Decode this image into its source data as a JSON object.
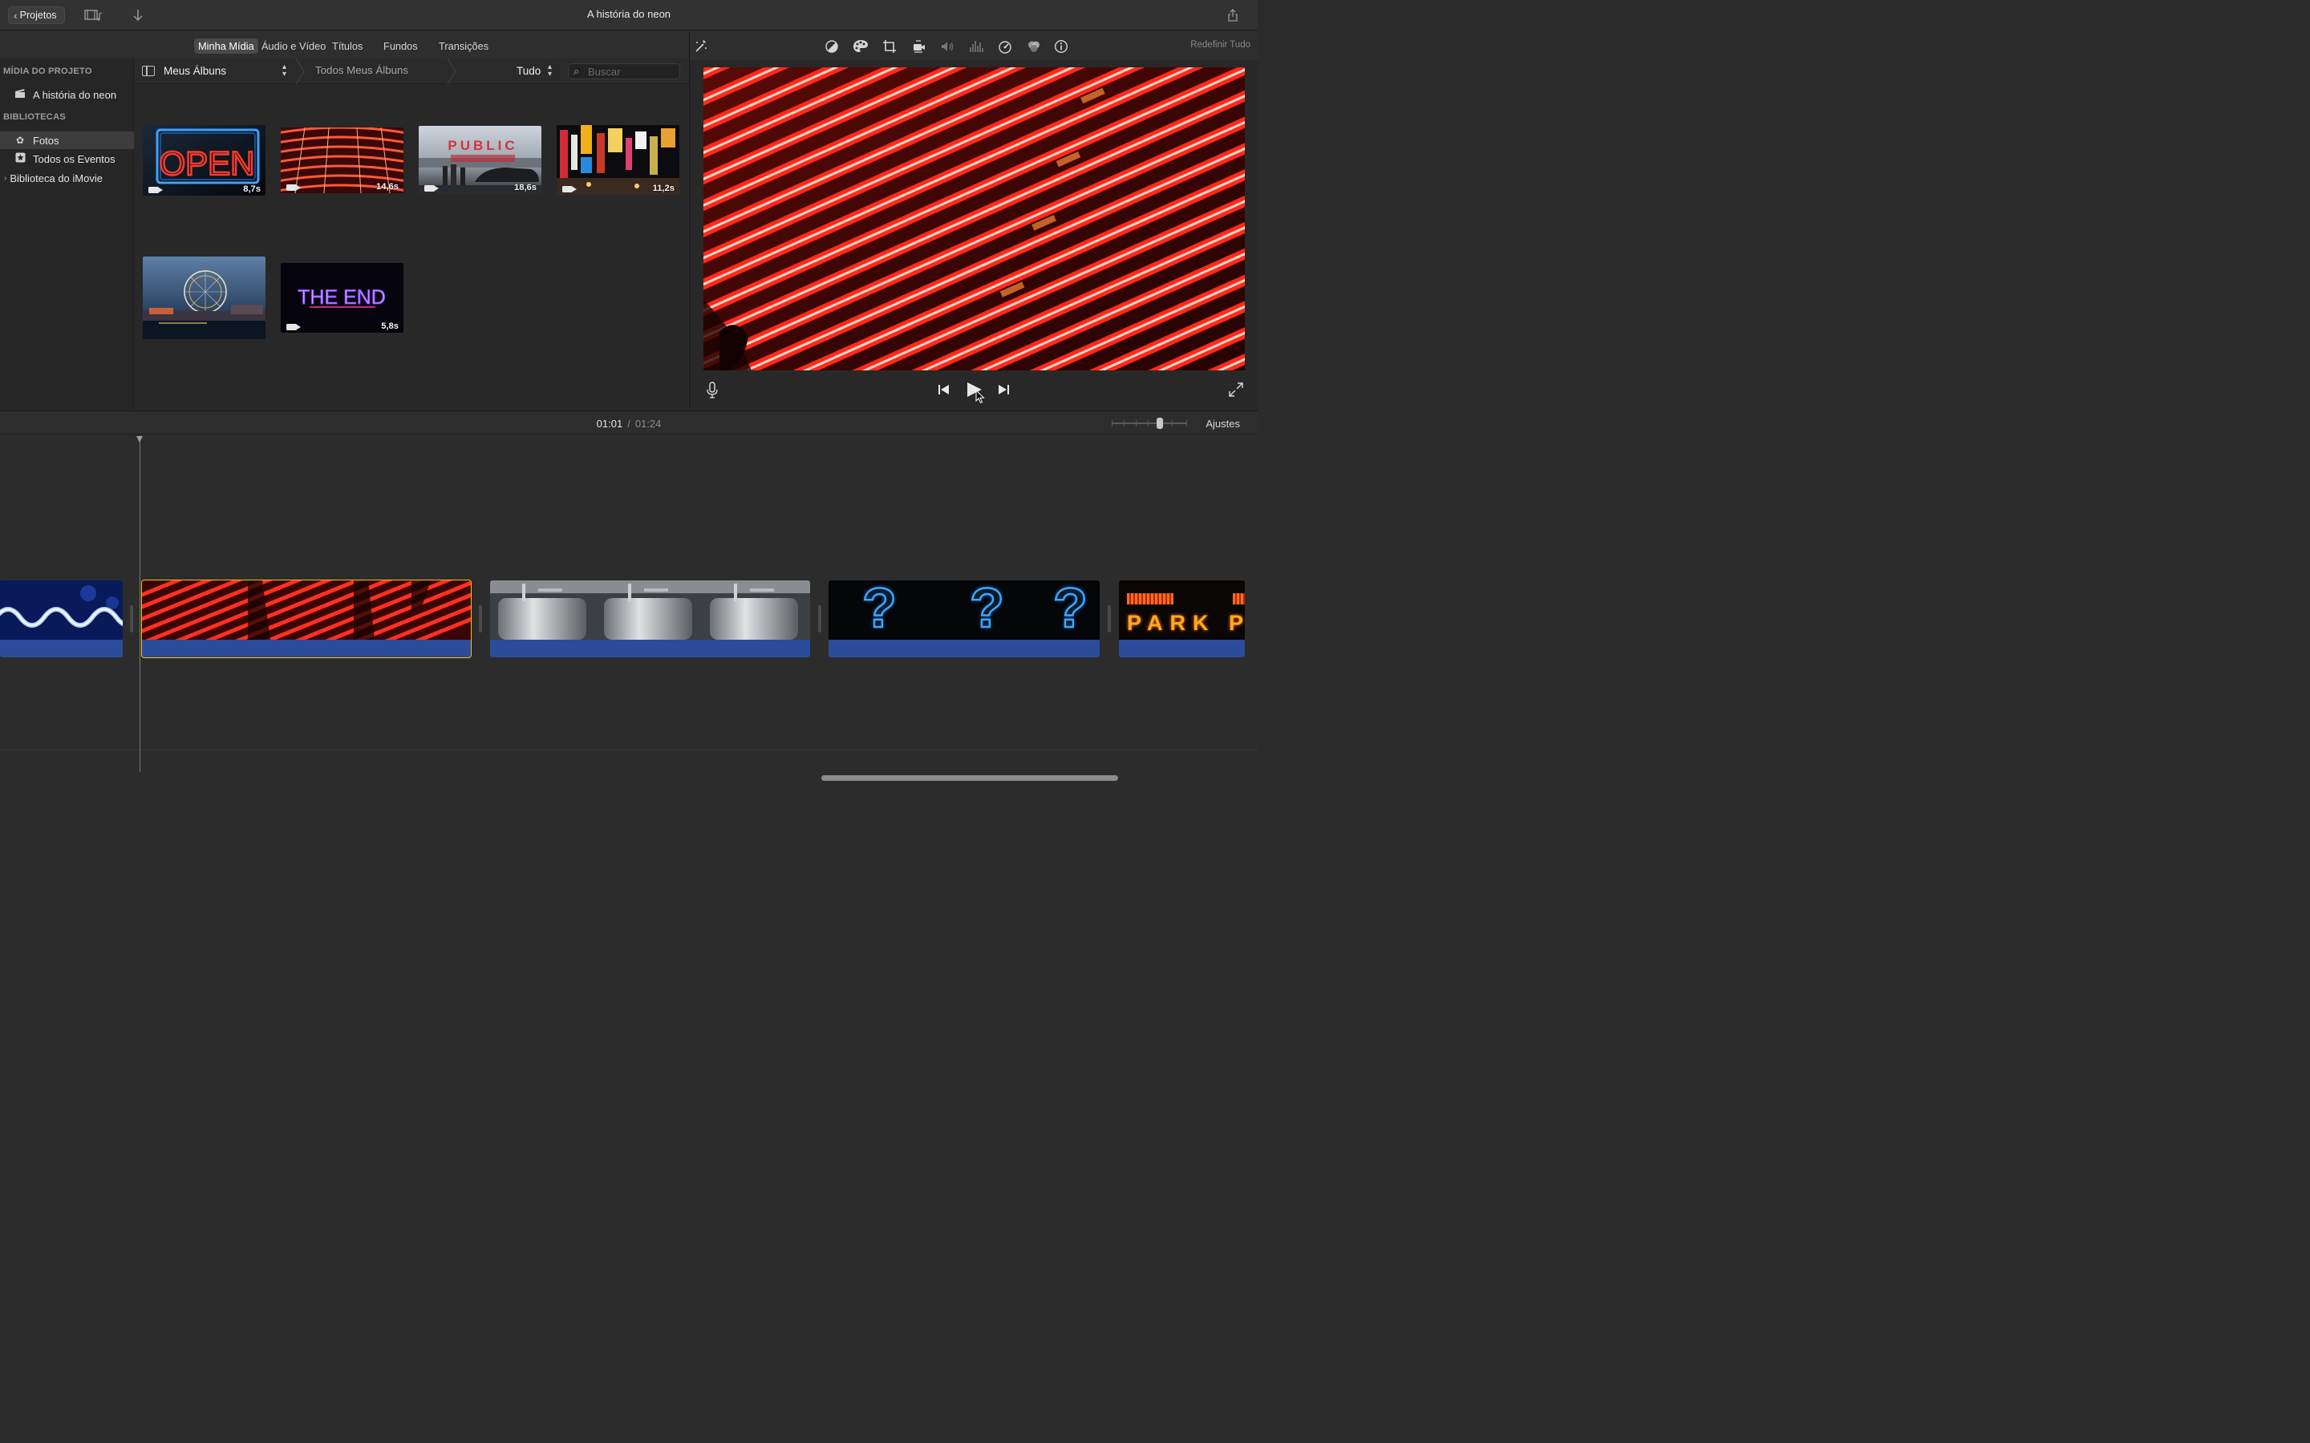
{
  "toolbar": {
    "back_label": "Projetos",
    "window_title": "A história do neon"
  },
  "tabs": [
    {
      "label": "Minha Mídia",
      "active": true
    },
    {
      "label": "Áudio e Vídeo",
      "active": false
    },
    {
      "label": "Títulos",
      "active": false
    },
    {
      "label": "Fundos",
      "active": false
    },
    {
      "label": "Transições",
      "active": false
    }
  ],
  "sidebar": {
    "project_section": "MÍDIA DO PROJETO",
    "project_item": "A história do neon",
    "libraries_section": "BIBLIOTECAS",
    "items": [
      {
        "label": "Fotos",
        "selected": true
      },
      {
        "label": "Todos os Eventos",
        "selected": false
      },
      {
        "label": "Biblioteca do iMovie",
        "selected": false
      }
    ]
  },
  "browser": {
    "album": "Meus Álbuns",
    "breadcrumb": "Todos Meus Álbuns",
    "filter": "Tudo",
    "search_placeholder": "Buscar"
  },
  "media": [
    {
      "name": "open-sign-clip",
      "duration": "8,7s",
      "has_video": true
    },
    {
      "name": "red-neon-arcs-clip",
      "duration": "14,6s",
      "has_video": true
    },
    {
      "name": "public-market-clip",
      "duration": "18,6s",
      "has_video": true
    },
    {
      "name": "city-signs-clip",
      "duration": "11,2s",
      "has_video": true
    },
    {
      "name": "ferris-wheel-photo",
      "duration": "",
      "has_video": false
    },
    {
      "name": "the-end-clip",
      "duration": "5,8s",
      "has_video": true
    }
  ],
  "media_text": {
    "public_market": "PUBLIC",
    "the_end": "THE END",
    "open": "OPEN"
  },
  "viewer": {
    "reset_label": "Redefinir Tudo"
  },
  "timeline": {
    "current_time": "01:01",
    "separator": "/",
    "total_time": "01:24",
    "settings_label": "Ajustes",
    "park_text": "PARK P",
    "question_mark": "?"
  },
  "colors": {
    "accent_blue": "#2a4c9a",
    "selection_yellow": "#f0c419",
    "neon_red": "#ff3a2a"
  }
}
